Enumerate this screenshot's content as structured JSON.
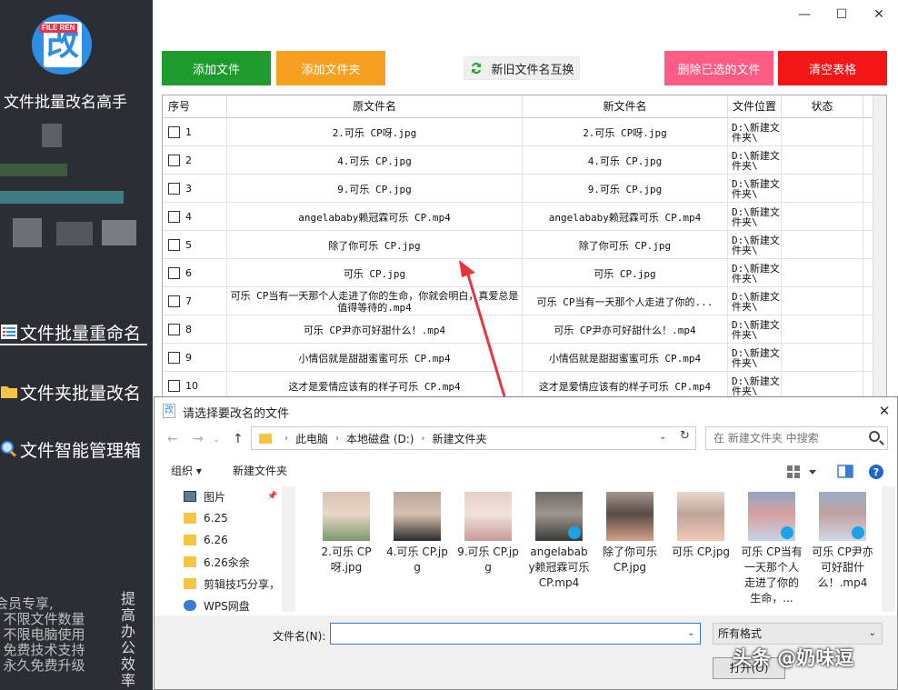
{
  "app": {
    "logo_tag": "FILE REN",
    "logo_char": "改",
    "title": "文件批量改名高手"
  },
  "sidebar": {
    "items": [
      {
        "label": "文件批量重命名",
        "icon": "list-icon"
      },
      {
        "label": "文件夹批量改名",
        "icon": "folder-icon"
      },
      {
        "label": "文件智能管理箱",
        "icon": "magnifier-icon"
      }
    ],
    "member_lines": [
      "会员专享,",
      "· 不限文件数量",
      "· 不限电脑使用",
      "· 免费技术支持",
      "· 永久免费升级"
    ],
    "vertical_text": "提高办公效率"
  },
  "window": {
    "minimize": "—",
    "maximize": "☐",
    "close": "✕"
  },
  "toolbar": {
    "add_file": "添加文件",
    "add_folder": "添加文件夹",
    "swap_names": "新旧文件名互换",
    "delete_selected": "删除已选的文件",
    "clear_table": "清空表格"
  },
  "table": {
    "headers": [
      "序号",
      "原文件名",
      "新文件名",
      "文件位置",
      "状态"
    ],
    "rows": [
      {
        "idx": "1",
        "orig": "2.可乐  CP呀.jpg",
        "new": "2.可乐  CP呀.jpg",
        "loc": "D:\\新建文件夹\\",
        "status": ""
      },
      {
        "idx": "2",
        "orig": "4.可乐  CP.jpg",
        "new": "4.可乐  CP.jpg",
        "loc": "D:\\新建文件夹\\",
        "status": ""
      },
      {
        "idx": "3",
        "orig": "9.可乐  CP.jpg",
        "new": "9.可乐  CP.jpg",
        "loc": "D:\\新建文件夹\\",
        "status": ""
      },
      {
        "idx": "4",
        "orig": "angelababy赖冠霖可乐  CP.mp4",
        "new": "angelababy赖冠霖可乐  CP.mp4",
        "loc": "D:\\新建文件夹\\",
        "status": ""
      },
      {
        "idx": "5",
        "orig": "除了你可乐  CP.jpg",
        "new": "除了你可乐  CP.jpg",
        "loc": "D:\\新建文件夹\\",
        "status": ""
      },
      {
        "idx": "6",
        "orig": "可乐  CP.jpg",
        "new": "可乐  CP.jpg",
        "loc": "D:\\新建文件夹\\",
        "status": ""
      },
      {
        "idx": "7",
        "orig": "可乐  CP当有一天那个人走进了你的生命，你就会明白，真爱总是值得等待的.mp4",
        "new": "可乐  CP当有一天那个人走进了你的...",
        "loc": "D:\\新建文件夹\\",
        "status": ""
      },
      {
        "idx": "8",
        "orig": "可乐  CP尹亦可好甜什么！.mp4",
        "new": "可乐  CP尹亦可好甜什么！.mp4",
        "loc": "D:\\新建文件夹\\",
        "status": ""
      },
      {
        "idx": "9",
        "orig": "小情侣就是甜甜蜜蜜可乐  CP.mp4",
        "new": "小情侣就是甜甜蜜蜜可乐  CP.mp4",
        "loc": "D:\\新建文件夹\\",
        "status": ""
      },
      {
        "idx": "10",
        "orig": "这才是爱情应该有的样子可乐  CP.mp4",
        "new": "这才是爱情应该有的样子可乐  CP.mp4",
        "loc": "D:\\新建文件夹\\",
        "status": ""
      }
    ]
  },
  "dialog": {
    "title_icon": "改",
    "title": "请选择要改名的文件",
    "breadcrumb": [
      "此电脑",
      "本地磁盘 (D:)",
      "新建文件夹"
    ],
    "search_placeholder": "在 新建文件夹 中搜索",
    "organize": "组织 ▾",
    "new_folder": "新建文件夹",
    "tree": [
      {
        "label": "图片",
        "type": "pictures"
      },
      {
        "label": "6.25",
        "type": "folder"
      },
      {
        "label": "6.26",
        "type": "folder"
      },
      {
        "label": "6.26汆余",
        "type": "folder"
      },
      {
        "label": "剪辑技巧分享，",
        "type": "folder"
      },
      {
        "label": "WPS网盘",
        "type": "cloud"
      }
    ],
    "files": [
      {
        "name": "2.可乐  CP呀.jpg",
        "kind": "image"
      },
      {
        "name": "4.可乐  CP.jpg",
        "kind": "image"
      },
      {
        "name": "9.可乐  CP.jpg",
        "kind": "image"
      },
      {
        "name": "angelababy赖冠霖可乐  CP.mp4",
        "kind": "video"
      },
      {
        "name": "除了你可乐  CP.jpg",
        "kind": "image"
      },
      {
        "name": "可乐  CP.jpg",
        "kind": "image"
      },
      {
        "name": "可乐  CP当有一天那个人走进了你的生命，...",
        "kind": "video"
      },
      {
        "name": "可乐  CP尹亦可好甜什么！.mp4",
        "kind": "video"
      }
    ],
    "filename_label": "文件名(N):",
    "filename_value": "",
    "filetype": "所有格式",
    "open_button": "打开(O)"
  },
  "watermark": "头条 @奶味逗",
  "colors": {
    "sidebar_bg": "#2b2f35",
    "add_file": "#1f9a2c",
    "add_folder": "#f5a020",
    "delete": "#ff5b85",
    "clear": "#f41616",
    "arrow": "#e8343f"
  }
}
